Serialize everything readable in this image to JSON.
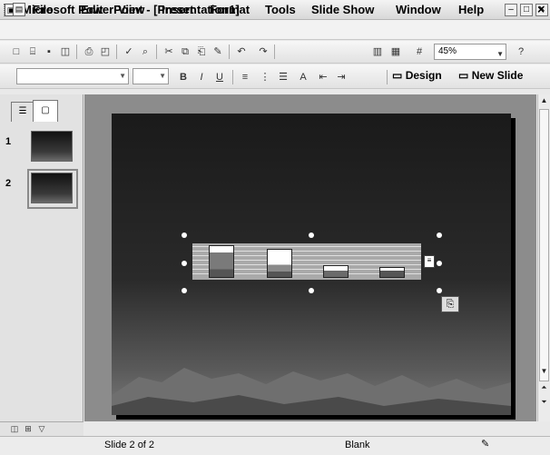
{
  "window": {
    "title": "Microsoft PowerPoint - [Presentation1]",
    "minimize_icon": "minimize-icon",
    "maximize_icon": "maximize-icon",
    "close_icon": "close-icon"
  },
  "menu": {
    "items": [
      "File",
      "Edit",
      "View",
      "Insert",
      "Format",
      "Tools",
      "Slide Show",
      "Window",
      "Help"
    ],
    "close_glyph": "×"
  },
  "standard_toolbar": {
    "zoom": "45%",
    "icons": [
      "new-icon",
      "open-icon",
      "save-icon",
      "permission-icon",
      "print-icon",
      "print-preview-icon",
      "spelling-icon",
      "research-icon",
      "cut-icon",
      "copy-icon",
      "paste-icon",
      "format-painter-icon",
      "undo-icon",
      "redo-icon",
      "insert-chart-icon",
      "insert-table-icon",
      "grid-icon",
      "help-icon"
    ]
  },
  "formatting_toolbar": {
    "design_label": "Design",
    "new_slide_label": "New Slide",
    "icons": [
      "bold-icon",
      "italic-icon",
      "underline-icon",
      "align-icon",
      "numbering-icon",
      "bullets-icon",
      "font-size-icon",
      "decrease-indent-icon",
      "increase-indent-icon"
    ]
  },
  "slides_pane": {
    "slides": [
      {
        "number": "1"
      },
      {
        "number": "2",
        "selected": true
      }
    ]
  },
  "slide": {
    "background": "dark gradient with mountain silhouette",
    "chart": {
      "type": "bar",
      "bar_colors": [
        "#7a7a7a",
        "#ffffff",
        "#555555"
      ],
      "categories_count": 4
    }
  },
  "status": {
    "slide_position": "Slide 2 of 2",
    "design_name": "Blank"
  },
  "colors": {
    "window_bg": "#e9e9e9",
    "canvas_bg": "#8c8c8c",
    "slide_dark": "#1a1a1a"
  }
}
